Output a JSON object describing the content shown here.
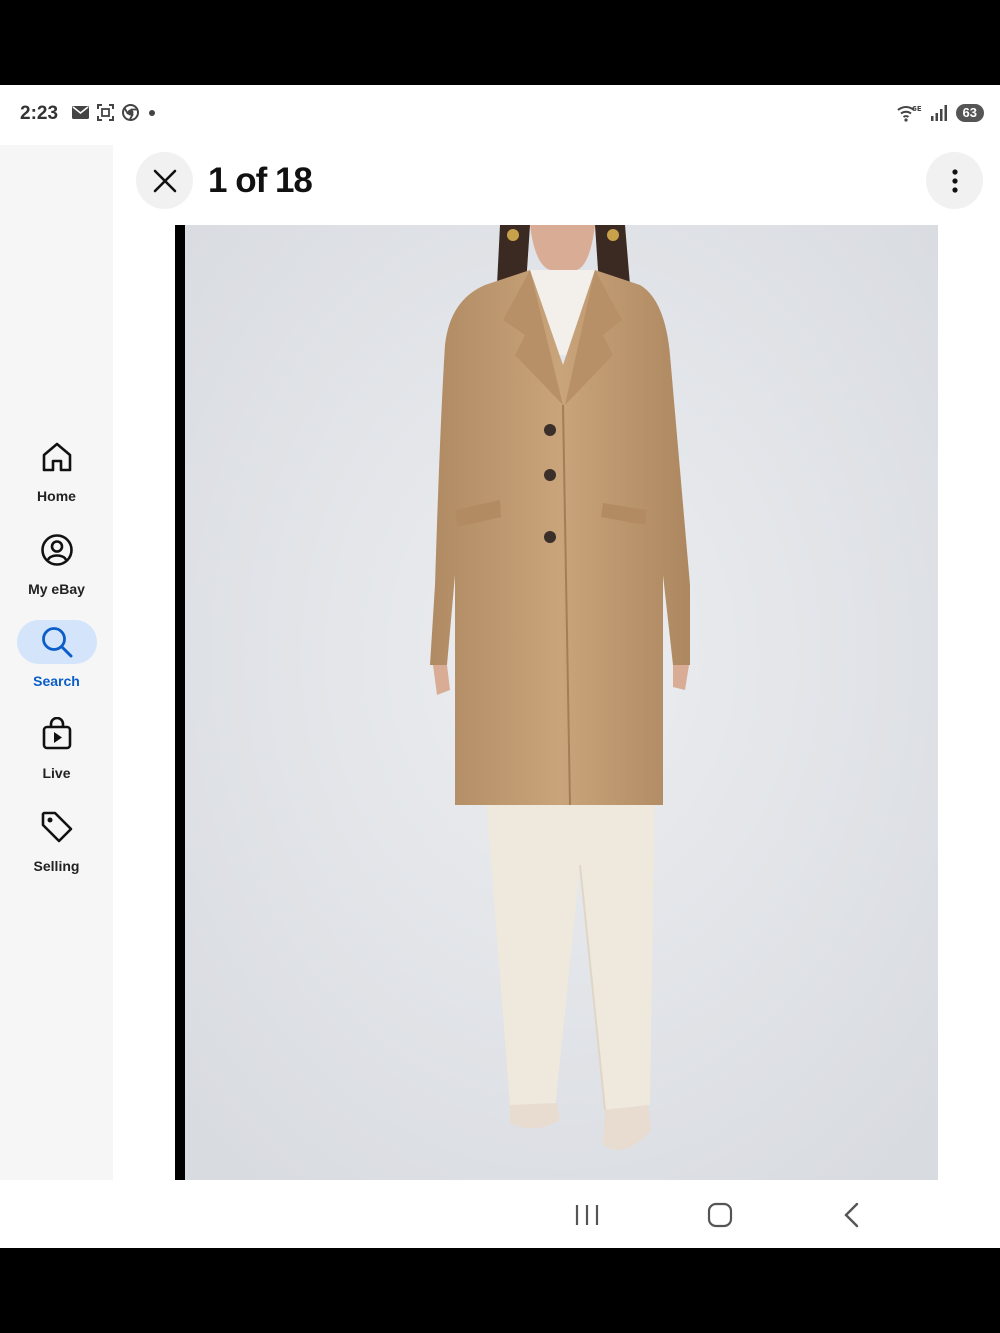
{
  "status_bar": {
    "time": "2:23",
    "left_icons": [
      "mail-icon",
      "screenshot-icon",
      "chrome-icon",
      "dot-icon"
    ],
    "right_icons": [
      "wifi-6e-icon",
      "signal-icon"
    ],
    "battery": "63"
  },
  "header": {
    "counter": "1 of 18",
    "close_icon": "close-icon",
    "more_icon": "more-vertical-icon"
  },
  "sidebar": {
    "items": [
      {
        "label": "Home",
        "icon": "home-icon",
        "active": false
      },
      {
        "label": "My eBay",
        "icon": "user-circle-icon",
        "active": false
      },
      {
        "label": "Search",
        "icon": "search-icon",
        "active": true
      },
      {
        "label": "Live",
        "icon": "live-bag-icon",
        "active": false
      },
      {
        "label": "Selling",
        "icon": "tag-icon",
        "active": false
      }
    ]
  },
  "photo": {
    "subject": "camel-coat-photo"
  },
  "colors": {
    "accent": "#0b5ec9",
    "active_pill": "#d4e4fb",
    "coat": "#c49d74",
    "trousers": "#f1ebe0"
  },
  "system_nav": [
    "recents-icon",
    "home-circle-icon",
    "back-icon"
  ]
}
